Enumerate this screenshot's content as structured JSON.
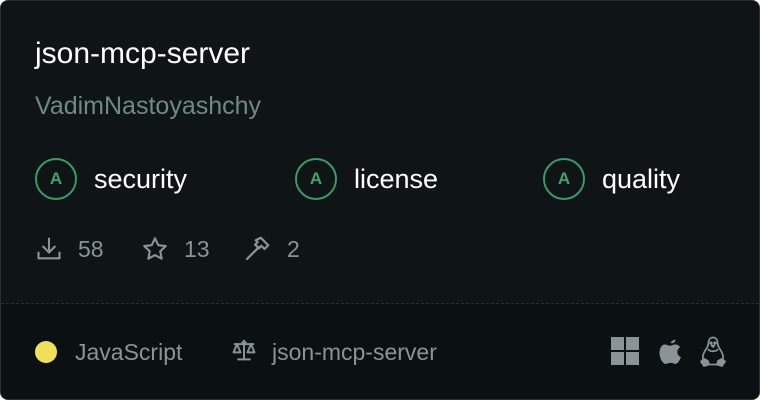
{
  "server": {
    "name": "json-mcp-server",
    "owner": "VadimNastoyashchy"
  },
  "grades": [
    {
      "letter": "A",
      "label": "security"
    },
    {
      "letter": "A",
      "label": "license"
    },
    {
      "letter": "A",
      "label": "quality"
    }
  ],
  "stats": {
    "downloads": "58",
    "stars": "13",
    "tools": "2"
  },
  "footer": {
    "language": "JavaScript",
    "language_color": "#f1e05a",
    "license_name": "json-mcp-server",
    "platforms": [
      "windows-icon",
      "apple-icon",
      "linux-icon"
    ]
  },
  "colors": {
    "grade_accent": "#3a9a66",
    "background": "#0f1417",
    "muted_text": "#8b9398"
  }
}
